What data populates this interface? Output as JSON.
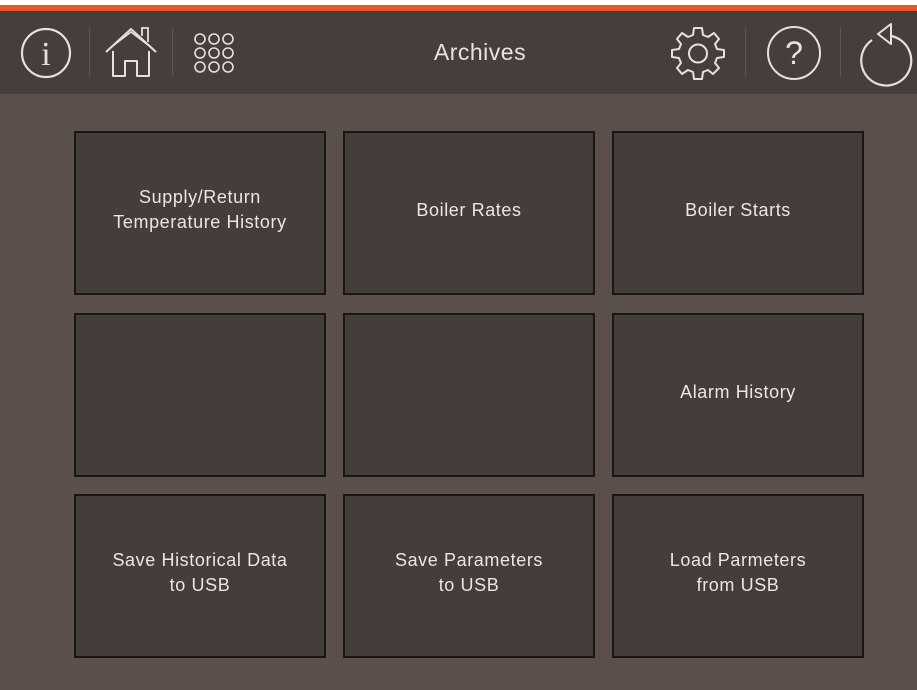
{
  "header": {
    "title": "Archives"
  },
  "tiles": [
    {
      "label": "Supply/Return\nTemperature History"
    },
    {
      "label": "Boiler Rates"
    },
    {
      "label": "Boiler Starts"
    },
    {
      "label": ""
    },
    {
      "label": ""
    },
    {
      "label": "Alarm History"
    },
    {
      "label": "Save Historical Data\nto USB"
    },
    {
      "label": "Save Parameters\nto USB"
    },
    {
      "label": "Load Parmeters\nfrom USB"
    }
  ],
  "icons": {
    "info": "info-icon",
    "home": "home-icon",
    "menu": "grid-menu-icon",
    "settings": "gear-icon",
    "help": "help-icon",
    "back": "back-icon"
  },
  "colors": {
    "accent": "#e8552a",
    "header_bg": "#463e3b",
    "page_bg": "#5a4f4a",
    "tile_bg": "#453d3a",
    "text": "#ebe6e3"
  }
}
